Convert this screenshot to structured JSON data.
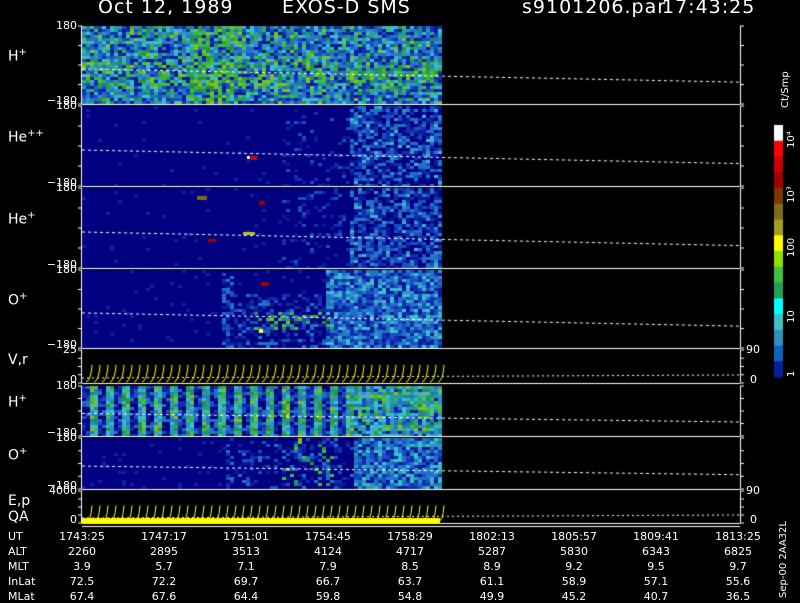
{
  "header": {
    "date": "Oct 12, 1989",
    "instrument": "EXOS-D SMS",
    "file": "s9101206.par",
    "time": "17:43:25"
  },
  "panels": [
    {
      "name": "H+",
      "ion": "H",
      "charge": "+",
      "ymax": "180",
      "ymin": "−180",
      "kind": "spectrogram",
      "style": "hplus"
    },
    {
      "name": "He++",
      "ion": "He",
      "charge": "++",
      "ymax": "180",
      "ymin": "−180",
      "kind": "spectrogram",
      "style": "hepp"
    },
    {
      "name": "He+",
      "ion": "He",
      "charge": "+",
      "ymax": "180",
      "ymin": "−180",
      "kind": "spectrogram",
      "style": "hep"
    },
    {
      "name": "O+",
      "ion": "O",
      "charge": "+",
      "ymax": "180",
      "ymin": "−180",
      "kind": "spectrogram",
      "style": "op"
    },
    {
      "name": "V,r",
      "label": "V,r",
      "ymax": "25",
      "ymin": "0",
      "right_top": "90",
      "right_bottom": "0",
      "kind": "sweep"
    },
    {
      "name": "H+ (2)",
      "ion": "H",
      "charge": "+",
      "ymax": "180",
      "ymin": "−180",
      "kind": "spectrogram",
      "style": "h2"
    },
    {
      "name": "O+ (2)",
      "ion": "O",
      "charge": "+",
      "ymax": "180",
      "ymin": "−180",
      "kind": "spectrogram",
      "style": "o2"
    },
    {
      "name": "E,p",
      "label": "E,p",
      "ymax": "4000",
      "ymin": "0",
      "right_top": "90",
      "right_bottom": "0",
      "kind": "sweep"
    }
  ],
  "qa_label": "QA",
  "colorbar": {
    "label": "Ct/Smp",
    "ticks": [
      "10⁴",
      "10³",
      "100",
      "10",
      "1"
    ],
    "colors": [
      "#ffffff",
      "#ff0000",
      "#c80000",
      "#a00000",
      "#7a3800",
      "#806a20",
      "#a0a020",
      "#ffff00",
      "#90e000",
      "#40c040",
      "#20a050",
      "#00ffff",
      "#40c0c0",
      "#3090c0",
      "#1060c0",
      "#0020a0"
    ]
  },
  "footer_rows": [
    {
      "label": "UT",
      "values": [
        "1743:25",
        "1747:17",
        "1751:01",
        "1754:45",
        "1758:29",
        "1802:13",
        "1805:57",
        "1809:41",
        "1813:25"
      ]
    },
    {
      "label": "ALT",
      "values": [
        "2260",
        "2895",
        "3513",
        "4124",
        "4717",
        "5287",
        "5830",
        "6343",
        "6825"
      ]
    },
    {
      "label": "MLT",
      "values": [
        "3.9",
        "5.7",
        "7.1",
        "7.9",
        "8.5",
        "8.9",
        "9.2",
        "9.5",
        "9.7"
      ]
    },
    {
      "label": "InLat",
      "values": [
        "72.5",
        "72.2",
        "69.7",
        "66.7",
        "63.7",
        "61.1",
        "58.9",
        "57.1",
        "55.6"
      ]
    },
    {
      "label": "MLat",
      "values": [
        "67.4",
        "67.6",
        "64.4",
        "59.8",
        "54.8",
        "49.9",
        "45.2",
        "40.7",
        "36.5"
      ]
    }
  ],
  "side_note": "Sep-00  2AA32L",
  "chart_data": {
    "type": "heatmap",
    "x": [
      "1743:25",
      "1747:17",
      "1751:01",
      "1754:45",
      "1758:29",
      "1802:13",
      "1805:57",
      "1809:41",
      "1813:25"
    ],
    "data_coverage_end": "~1759:00",
    "series": [
      {
        "name": "H+",
        "ylim": [
          -180,
          180
        ]
      },
      {
        "name": "He++",
        "ylim": [
          -180,
          180
        ]
      },
      {
        "name": "He+",
        "ylim": [
          -180,
          180
        ]
      },
      {
        "name": "O+",
        "ylim": [
          -180,
          180
        ]
      },
      {
        "name": "V,r",
        "ylim": [
          0,
          25
        ],
        "right_ylim": [
          0,
          90
        ]
      },
      {
        "name": "H+",
        "ylim": [
          -180,
          180
        ]
      },
      {
        "name": "O+",
        "ylim": [
          -180,
          180
        ]
      },
      {
        "name": "E,p",
        "ylim": [
          0,
          4000
        ],
        "right_ylim": [
          0,
          90
        ]
      }
    ],
    "colorbar_range": [
      1,
      10000
    ],
    "colorbar_scale": "log",
    "colorbar_unit": "Ct/Smp"
  }
}
